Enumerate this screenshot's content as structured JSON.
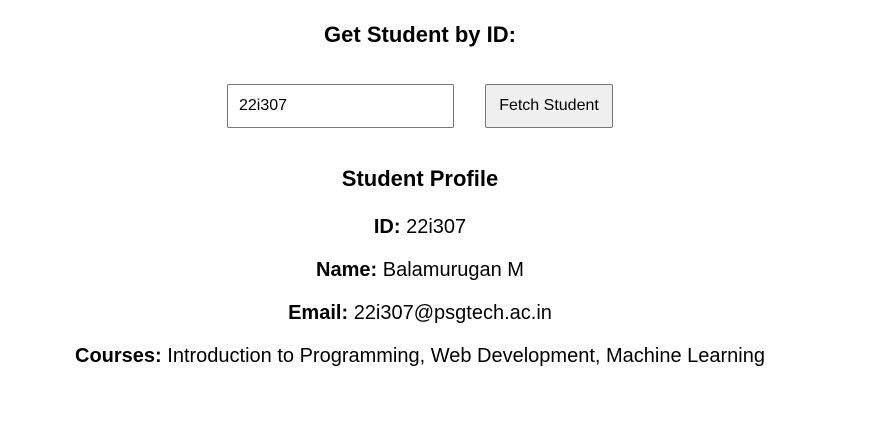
{
  "search": {
    "heading": "Get Student by ID:",
    "input_value": "22i307",
    "button_label": "Fetch Student"
  },
  "profile": {
    "heading": "Student Profile",
    "id_label": "ID:",
    "id_value": "22i307",
    "name_label": "Name:",
    "name_value": "Balamurugan M",
    "email_label": "Email:",
    "email_value": "22i307@psgtech.ac.in",
    "courses_label": "Courses:",
    "courses_value": "Introduction to Programming, Web Development, Machine Learning"
  }
}
